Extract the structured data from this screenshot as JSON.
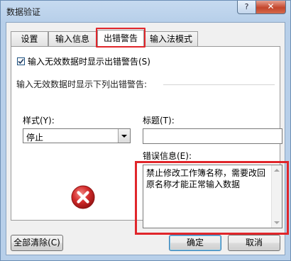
{
  "window": {
    "title": "数据验证",
    "help_label": "?",
    "close_label": "✕"
  },
  "tabs": [
    {
      "label": "设置"
    },
    {
      "label": "输入信息"
    },
    {
      "label": "出错警告"
    },
    {
      "label": "输入法模式"
    }
  ],
  "error_alert": {
    "show_checkbox_label": "输入无效数据时显示出错警告(S)",
    "show_checked": true,
    "section_label": "输入无效数据时显示下列出错警告:",
    "style_label": "样式(Y):",
    "style_value": "停止",
    "title_label": "标题(T):",
    "title_value": "",
    "message_label": "错误信息(E):",
    "message_value": "禁止修改工作簿名称，需要改回原名称才能正常输入数据",
    "icon": "error-stop-icon"
  },
  "footer": {
    "clear_all_label": "全部清除(C)",
    "ok_label": "确定",
    "cancel_label": "取消"
  },
  "colors": {
    "highlight": "#e0262b",
    "error_icon": "#d32b2b"
  }
}
